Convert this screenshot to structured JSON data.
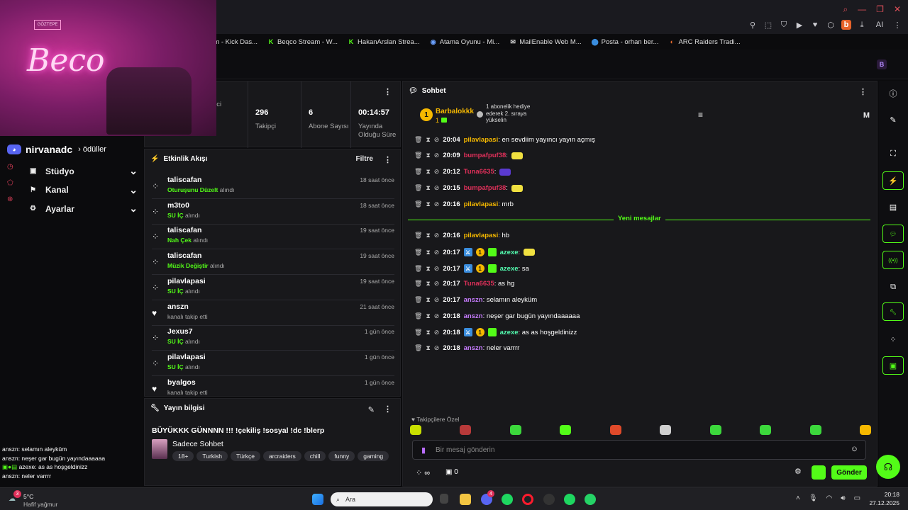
{
  "browser": {
    "bookmarks": [
      {
        "label": "am - Kick Das...",
        "icon": "kick-icon",
        "color": "#53fc18"
      },
      {
        "label": "Beqco Stream - W...",
        "icon": "kick-icon",
        "color": "#53fc18"
      },
      {
        "label": "HakanArslan Strea...",
        "icon": "kick-icon",
        "color": "#53fc18"
      },
      {
        "label": "Atama Oyunu - Mi...",
        "icon": "globe-icon",
        "color": "#6aa0ff"
      },
      {
        "label": "MailEnable Web M...",
        "icon": "mail-icon",
        "color": "#cccccc"
      },
      {
        "label": "Posta - orhan ber...",
        "icon": "outlook-icon",
        "color": "#3a8dde"
      },
      {
        "label": "ARC Raiders Tradi...",
        "icon": "arc-icon",
        "color": "#e86a2c"
      }
    ],
    "profile_letter": "b",
    "ai_label": "AI"
  },
  "camera": {
    "sign_text": "GÖZTEPE",
    "neon_text": "Beco"
  },
  "left_nav": {
    "username": "nirvanadc",
    "rewards_fragment": "› ödüller",
    "items": [
      {
        "label": "Stüdyo",
        "icon": "studio-icon"
      },
      {
        "label": "Kanal",
        "icon": "channel-icon"
      },
      {
        "label": "Ayarlar",
        "icon": "gear-icon"
      }
    ]
  },
  "overlay_chat": [
    {
      "user": "anszn",
      "text": ": selamın aleyküm"
    },
    {
      "user": "anszn",
      "text": ": neşer gar bugün yayındaaaaaa"
    },
    {
      "user": "azexe",
      "text": ": as as hoşgeldinizz"
    },
    {
      "user": "anszn",
      "text": ": neler varrrr"
    }
  ],
  "stats": [
    {
      "value": "",
      "label": "rici"
    },
    {
      "value": "296",
      "label": "Takipçi"
    },
    {
      "value": "6",
      "label": "Abone Sayısı"
    },
    {
      "value": "00:14:57",
      "label": "Yayında Olduğu Süre"
    }
  ],
  "feed": {
    "title": "Etkinlik Akışı",
    "filter": "Filtre",
    "items": [
      {
        "user": "taliscafan",
        "action": "Oturuşunu Düzelt",
        "suffix": " alındı",
        "time": "18 saat önce",
        "icon": "points"
      },
      {
        "user": "m3to0",
        "action": "SU İÇ",
        "suffix": " alındı",
        "time": "18 saat önce",
        "icon": "points"
      },
      {
        "user": "taliscafan",
        "action": "Nah Çek",
        "suffix": " alındı",
        "time": "19 saat önce",
        "icon": "points"
      },
      {
        "user": "taliscafan",
        "action": "Müzik Değiştir",
        "suffix": " alındı",
        "time": "19 saat önce",
        "icon": "points"
      },
      {
        "user": "pilavlapasi",
        "action": "SU İÇ",
        "suffix": " alındı",
        "time": "19 saat önce",
        "icon": "points"
      },
      {
        "user": "anszn",
        "action": "",
        "suffix": "kanalı takip etti",
        "time": "21 saat önce",
        "icon": "heart"
      },
      {
        "user": "Jexus7",
        "action": "SU İÇ",
        "suffix": " alındı",
        "time": "1 gün önce",
        "icon": "points"
      },
      {
        "user": "pilavlapasi",
        "action": "SU İÇ",
        "suffix": " alındı",
        "time": "1 gün önce",
        "icon": "points"
      },
      {
        "user": "byalgos",
        "action": "",
        "suffix": "kanalı takip etti",
        "time": "1 gün önce",
        "icon": "heart"
      }
    ]
  },
  "stream_info": {
    "title": "Yayın bilgisi",
    "stream_title": "BÜYÜKKK GÜNNNN !!! !çekiliş !sosyal !dc !blerp",
    "category": "Sadece Sohbet",
    "tags": [
      "18+",
      "Turkish",
      "Türkçe",
      "arcraiders",
      "chill",
      "funny",
      "gaming"
    ]
  },
  "chat": {
    "title": "Sohbet",
    "top_gifter": {
      "rank": "1",
      "name": "Barbalokkk",
      "count": "1"
    },
    "gift_text": "1 abonelik hediye ederek 2. sıraya yükselin",
    "right_letter": "M",
    "new_messages_label": "Yeni mesajlar",
    "messages": [
      {
        "time": "20:04",
        "user": "pilavlapasi",
        "color": "#f5b800",
        "text": ": en sevdiim yayıncı yayın açmış",
        "badges": []
      },
      {
        "time": "20:09",
        "user": "bumpafpuf38",
        "color": "#e0305a",
        "text": ":",
        "badges": []
      },
      {
        "time": "20:12",
        "user": "Tuna6635",
        "color": "#e0305a",
        "text": ":",
        "badges": []
      },
      {
        "time": "20:15",
        "user": "bumpafpuf38",
        "color": "#e0305a",
        "text": ":",
        "badges": []
      },
      {
        "time": "20:16",
        "user": "pilavlapasi",
        "color": "#f5b800",
        "text": ": mrb",
        "badges": []
      },
      {
        "time": "20:16",
        "user": "pilavlapasi",
        "color": "#f5b800",
        "text": ": hb",
        "badges": []
      },
      {
        "time": "20:17",
        "user": "azexe",
        "color": "#53fcb0",
        "text": ":",
        "badges": [
          "blue",
          "gold",
          "green"
        ]
      },
      {
        "time": "20:17",
        "user": "azexe",
        "color": "#53fcb0",
        "text": ": sa",
        "badges": [
          "blue",
          "gold",
          "green"
        ]
      },
      {
        "time": "20:17",
        "user": "Tuna6635",
        "color": "#e0305a",
        "text": ": as hg",
        "badges": []
      },
      {
        "time": "20:17",
        "user": "anszn",
        "color": "#c77dff",
        "text": ": selamın aleyküm",
        "badges": []
      },
      {
        "time": "20:18",
        "user": "anszn",
        "color": "#c77dff",
        "text": ": neşer gar bugün yayındaaaaaa",
        "badges": []
      },
      {
        "time": "20:18",
        "user": "azexe",
        "color": "#53fcb0",
        "text": ": as as hoşgeldinizz",
        "badges": [
          "blue",
          "gold",
          "green"
        ]
      },
      {
        "time": "20:18",
        "user": "anszn",
        "color": "#c77dff",
        "text": ": neler varrrr",
        "badges": []
      }
    ],
    "followers_only": "Takipçilere Özel",
    "input_placeholder": "Bir mesaj gönderin",
    "points": "∞",
    "chest_count": "0",
    "send_label": "Gönder"
  },
  "taskbar": {
    "weather_temp": "5°C",
    "weather_desc": "Hafif yağmur",
    "notif_count": "3",
    "search_placeholder": "Ara",
    "time": "20:18",
    "date": "27.12.2025",
    "discord_badge": "4"
  },
  "colors": {
    "accent": "#53fc18",
    "panel": "#18181b",
    "bg": "#0b0b0d"
  }
}
